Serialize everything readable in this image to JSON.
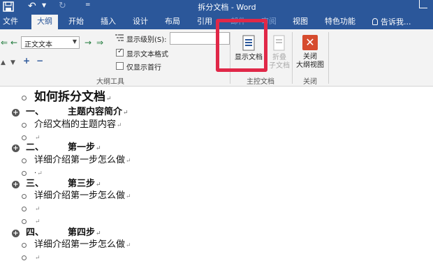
{
  "titlebar": {
    "title": "拆分文档 - Word",
    "qat_more": "="
  },
  "tabs": [
    {
      "label": "文件"
    },
    {
      "label": "大纲"
    },
    {
      "label": "开始"
    },
    {
      "label": "插入"
    },
    {
      "label": "设计"
    },
    {
      "label": "布局"
    },
    {
      "label": "引用"
    },
    {
      "label": "邮件"
    },
    {
      "label": "审阅"
    },
    {
      "label": "视图"
    },
    {
      "label": "特色功能"
    }
  ],
  "tellme": "告诉我...",
  "ribbon": {
    "outline_level_value": "正文文本",
    "show_level_label": "显示级别(S):",
    "show_text_format_label": "显示文本格式",
    "show_text_format_checked": true,
    "show_first_line_label": "仅显示首行",
    "show_first_line_checked": false,
    "group_outline_tools": "大纲工具",
    "show_document_label": "显示文档",
    "collapse_label": "折叠",
    "collapse_label2": "子文档",
    "group_master_doc": "主控文档",
    "close_label": "关闭",
    "close_label2": "大纲视图",
    "group_close": "关闭"
  },
  "document": {
    "title": "如何拆分文档",
    "mark": "↵",
    "sections": [
      {
        "number": "一、",
        "heading": "主题内容简介",
        "body": "介绍文档的主题内容"
      },
      {
        "number": "二、",
        "heading": "第一步",
        "body": "详细介绍第一步怎么做"
      },
      {
        "number": "三、",
        "heading": "第三步",
        "body": "详细介绍第一步怎么做"
      },
      {
        "number": "四、",
        "heading": "第四步",
        "body": "详细介绍第一步怎么做"
      }
    ]
  },
  "colors": {
    "brand": "#2b579a",
    "highlight": "#e02848",
    "close_button": "#d64b2e"
  }
}
